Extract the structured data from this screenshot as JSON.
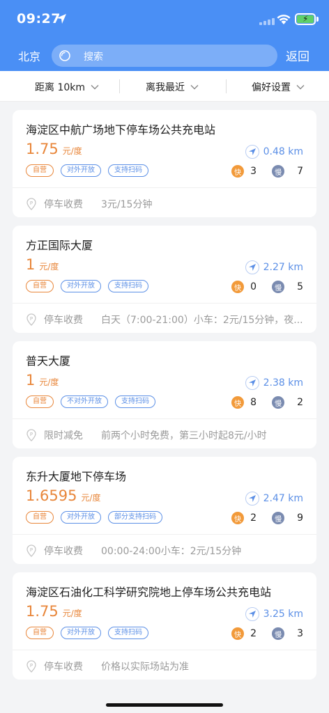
{
  "status_bar": {
    "time": "09:27"
  },
  "header": {
    "city": "北京",
    "search_placeholder": "搜索",
    "back_label": "返回"
  },
  "filters": [
    {
      "label": "距离 10km"
    },
    {
      "label": "离我最近"
    },
    {
      "label": "偏好设置"
    }
  ],
  "stations": [
    {
      "name": "海淀区中航广场地下停车场公共充电站",
      "price": "1.75",
      "unit": "元/度",
      "distance": "0.48 km",
      "tags": [
        "自营",
        "对外开放",
        "支持扫码"
      ],
      "fast_label": "快",
      "fast_count": "3",
      "slow_label": "慢",
      "slow_count": "7",
      "parking_label": "停车收费",
      "parking_value": "3元/15分钟"
    },
    {
      "name": "方正国际大厦",
      "price": "1",
      "unit": "元/度",
      "distance": "2.27 km",
      "tags": [
        "自营",
        "对外开放",
        "支持扫码"
      ],
      "fast_label": "快",
      "fast_count": "0",
      "slow_label": "慢",
      "slow_count": "5",
      "parking_label": "停车收费",
      "parking_value": "白天（7:00-21:00）小车：2元/15分钟，夜..."
    },
    {
      "name": "普天大厦",
      "price": "1",
      "unit": "元/度",
      "distance": "2.38 km",
      "tags": [
        "自营",
        "不对外开放",
        "支持扫码"
      ],
      "fast_label": "快",
      "fast_count": "8",
      "slow_label": "慢",
      "slow_count": "2",
      "parking_label": "限时减免",
      "parking_value": "前两个小时免费，第三小时起8元/小时"
    },
    {
      "name": "东升大厦地下停车场",
      "price": "1.6595",
      "unit": "元/度",
      "distance": "2.47 km",
      "tags": [
        "自营",
        "对外开放",
        "部分支持扫码"
      ],
      "fast_label": "快",
      "fast_count": "2",
      "slow_label": "慢",
      "slow_count": "9",
      "parking_label": "停车收费",
      "parking_value": "00:00-24:00小车：2元/15分钟"
    },
    {
      "name": "海淀区石油化工科学研究院地上停车场公共充电站",
      "price": "1.75",
      "unit": "元/度",
      "distance": "3.25 km",
      "tags": [
        "自营",
        "对外开放",
        "支持扫码"
      ],
      "fast_label": "快",
      "fast_count": "2",
      "slow_label": "慢",
      "slow_count": "3",
      "parking_label": "停车收费",
      "parking_value": "价格以实际场站为准"
    }
  ]
}
